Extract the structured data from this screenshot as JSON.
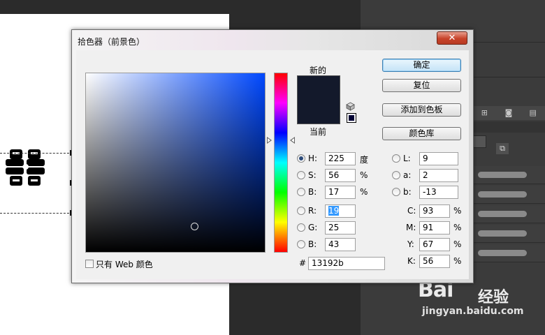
{
  "dialog": {
    "title": "拾色器（前景色）",
    "close_glyph": "✕",
    "new_label": "新的",
    "current_label": "当前",
    "buttons": {
      "ok": "确定",
      "reset": "复位",
      "add_swatch": "添加到色板",
      "color_libraries": "颜色库"
    },
    "new_color": "#13192b",
    "current_color": "#13192b",
    "websafe_color": "#000033",
    "hsb": {
      "h": {
        "label": "H:",
        "value": "225",
        "unit": "度"
      },
      "s": {
        "label": "S:",
        "value": "56",
        "unit": "%"
      },
      "b": {
        "label": "B:",
        "value": "17",
        "unit": "%"
      }
    },
    "rgb": {
      "r": {
        "label": "R:",
        "value": "19"
      },
      "g": {
        "label": "G:",
        "value": "25"
      },
      "b": {
        "label": "B:",
        "value": "43"
      }
    },
    "lab": {
      "l": {
        "label": "L:",
        "value": "9"
      },
      "a": {
        "label": "a:",
        "value": "2"
      },
      "b": {
        "label": "b:",
        "value": "-13"
      }
    },
    "cmyk": {
      "c": {
        "label": "C:",
        "value": "93",
        "unit": "%"
      },
      "m": {
        "label": "M:",
        "value": "91",
        "unit": "%"
      },
      "y": {
        "label": "Y:",
        "value": "67",
        "unit": "%"
      },
      "k": {
        "label": "K:",
        "value": "56",
        "unit": "%"
      }
    },
    "hex": {
      "label": "#",
      "value": "13192b"
    },
    "web_only_label": "只有 Web 颜色",
    "selected_mode": "H",
    "web_only_checked": false
  },
  "colors": {
    "accent_field": "#0048ff",
    "dialog_bg": "#f0f0f0",
    "workspace_bg": "#2b2b2b"
  },
  "watermark": {
    "logo": "Bai",
    "logo_suffix": "经验",
    "url": "jingyan.baidu.com"
  }
}
